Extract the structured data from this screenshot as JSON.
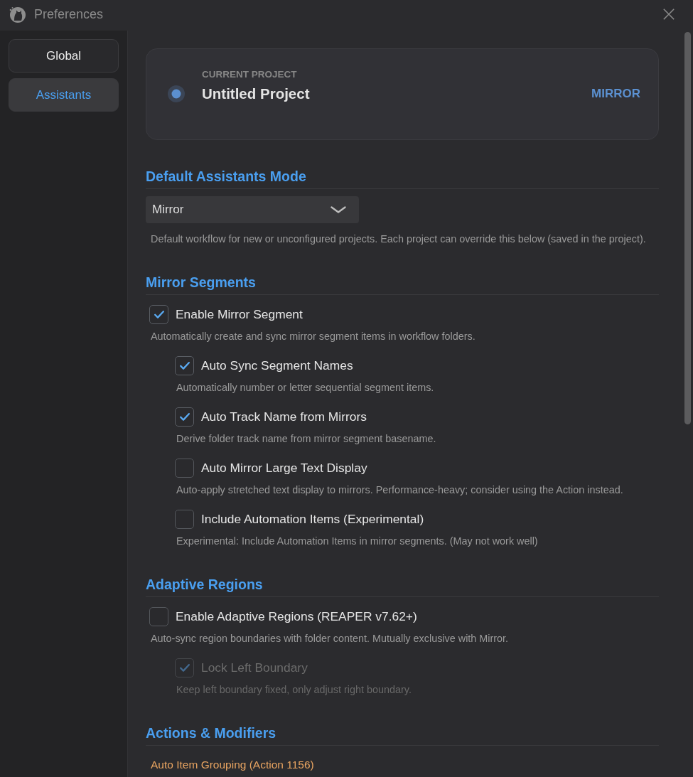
{
  "window": {
    "title": "Preferences"
  },
  "sidebar": {
    "items": [
      {
        "label": "Global",
        "selected": false
      },
      {
        "label": "Assistants",
        "selected": true
      }
    ]
  },
  "project_card": {
    "caption": "CURRENT PROJECT",
    "name": "Untitled Project",
    "mode": "MIRROR"
  },
  "sections": [
    {
      "heading": "Default Assistants Mode",
      "items": [
        {
          "kind": "dropdown",
          "value": "Mirror",
          "hint": "Default workflow for new or unconfigured projects. Each project can override this below (saved in the project)."
        }
      ]
    },
    {
      "heading": "Mirror Segments",
      "items": [
        {
          "kind": "checkbox",
          "label": "Enable Mirror Segment",
          "checked": true,
          "disabled": false,
          "hint": "Automatically create and sync mirror segment items in workflow folders.",
          "children": [
            {
              "label": "Auto Sync Segment Names",
              "checked": true,
              "disabled": false,
              "hint": "Automatically number or letter sequential segment items."
            },
            {
              "label": "Auto Track Name from Mirrors",
              "checked": true,
              "disabled": false,
              "hint": "Derive folder track name from mirror segment basename."
            },
            {
              "label": "Auto Mirror Large Text Display",
              "checked": false,
              "disabled": false,
              "hint": "Auto-apply stretched text display to mirrors. Performance-heavy; consider using the Action instead."
            },
            {
              "label": "Include Automation Items (Experimental)",
              "checked": false,
              "disabled": false,
              "hint": "Experimental: Include Automation Items in mirror segments. (May not work well)"
            }
          ]
        }
      ]
    },
    {
      "heading": "Adaptive Regions",
      "items": [
        {
          "kind": "checkbox",
          "label": "Enable Adaptive Regions (REAPER v7.62+)",
          "checked": false,
          "disabled": false,
          "hint": "Auto-sync region boundaries with folder content. Mutually exclusive with Mirror.",
          "children": [
            {
              "label": "Lock Left Boundary",
              "checked": true,
              "disabled": true,
              "hint": "Keep left boundary fixed, only adjust right boundary."
            }
          ]
        }
      ]
    },
    {
      "heading": "Actions & Modifiers",
      "items": [
        {
          "kind": "link",
          "label": "Auto Item Grouping (Action 1156)"
        }
      ]
    }
  ]
}
